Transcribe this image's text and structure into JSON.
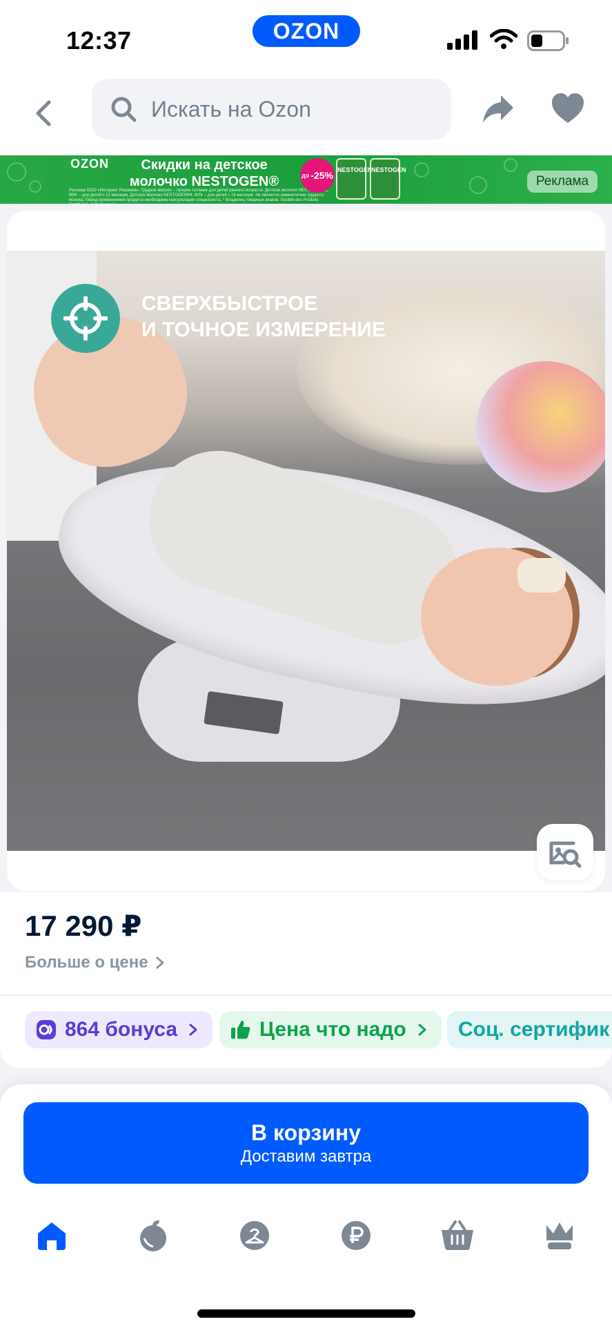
{
  "status_bar": {
    "time": "12:37",
    "logo": "OZON",
    "icons": [
      "signal-icon",
      "wifi-icon",
      "battery-icon"
    ]
  },
  "header": {
    "search_placeholder": "Искать на Ozon",
    "icons": [
      "chevron-left-icon",
      "search-icon",
      "share-icon",
      "heart-icon"
    ]
  },
  "banner": {
    "logo": "OZON",
    "title": "Скидки на детское молочко NESTOGEN®",
    "fine_print": "Реклама ООО «Интернет Решения». Грудное молоко – лучшее питание для детей раннего возраста. Детское молочко NESTOGEN®3, 800г – для детей с 12 месяцев. Детское молочко NESTOGEN®4, 800г – для детей с 18 месяцев. Не является заменителем грудного молока. Перед применением продукта необходима консультация специалиста. * Владелец товарных знаков: Société des Produits Nestlé S.A. (Швейцария)",
    "discount_prefix": "до",
    "discount": "-25%",
    "pack_label": "NESTOGEN",
    "ad_label": "Реклама"
  },
  "product": {
    "feature_line1": "СВЕРХБЫСТРОЕ",
    "feature_line2": "И ТОЧНОЕ ИЗМЕРЕНИЕ",
    "price": "17 290 ₽",
    "price_more": "Больше о цене",
    "chips": {
      "bonus": "864 бонуса",
      "price_good": "Цена что надо",
      "social": "Соц. сертифик"
    }
  },
  "cart": {
    "button_title": "В корзину",
    "button_sub": "Доставим завтра"
  },
  "tabbar": {
    "items": [
      "home-icon",
      "fresh-icon",
      "catalog-icon",
      "ruble-icon",
      "basket-icon",
      "crown-icon"
    ],
    "active_color": "#005bff",
    "inactive_color": "#7d8894"
  },
  "colors": {
    "brand": "#005bff",
    "banner_green": "#27a845",
    "bonus_purple": "#5c3bd6",
    "good_price_green": "#0ba44a",
    "social_teal": "#10a6a0"
  }
}
